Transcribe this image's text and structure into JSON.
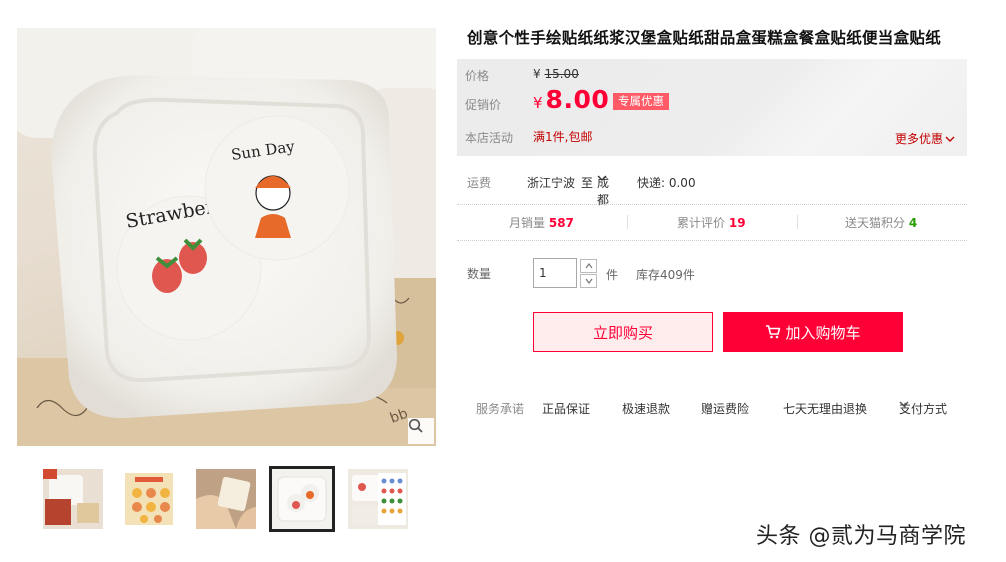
{
  "product": {
    "title": "创意个性手绘贴纸纸浆汉堡盒贴纸甜品盒蛋糕盒餐盒贴纸便当盒贴纸"
  },
  "price": {
    "orig_label": "价格",
    "orig_currency": "¥",
    "orig_value": "15.00",
    "promo_label": "促销价",
    "promo_currency": "¥",
    "promo_value": "8.00",
    "promo_tag": "专属优惠",
    "activity_label": "本店活动",
    "activity_text": "满1件,包邮",
    "more_offers": "更多优惠"
  },
  "shipping": {
    "label": "运费",
    "origin": "浙江宁波",
    "to": "至",
    "destination": "成都",
    "method": "快递: 0.00"
  },
  "stats": {
    "monthly_sales_label": "月销量",
    "monthly_sales_value": "587",
    "reviews_label": "累计评价",
    "reviews_value": "19",
    "points_label": "送天猫积分",
    "points_value": "4"
  },
  "quantity": {
    "label": "数量",
    "value": "1",
    "unit": "件",
    "stock": "库存409件"
  },
  "actions": {
    "buy_now": "立即购买",
    "add_to_cart": "加入购物车"
  },
  "service": {
    "label": "服务承诺",
    "items": [
      "正品保证",
      "极速退款",
      "赠运费险",
      "七天无理由退换"
    ],
    "payment": "支付方式"
  },
  "image_text": {
    "strawberry": "Strawberry",
    "sunday": "Sun Day"
  },
  "watermark": "头条 @贰为马商学院",
  "colors": {
    "tmall_red": "#ff0036",
    "promo_tag": "#ff5a66",
    "activity_red": "#c40000",
    "points_green": "#2a9d00"
  },
  "icons": [
    "zoom-icon",
    "chevron-down-icon",
    "cart-icon",
    "stepper-up-icon",
    "stepper-down-icon"
  ]
}
